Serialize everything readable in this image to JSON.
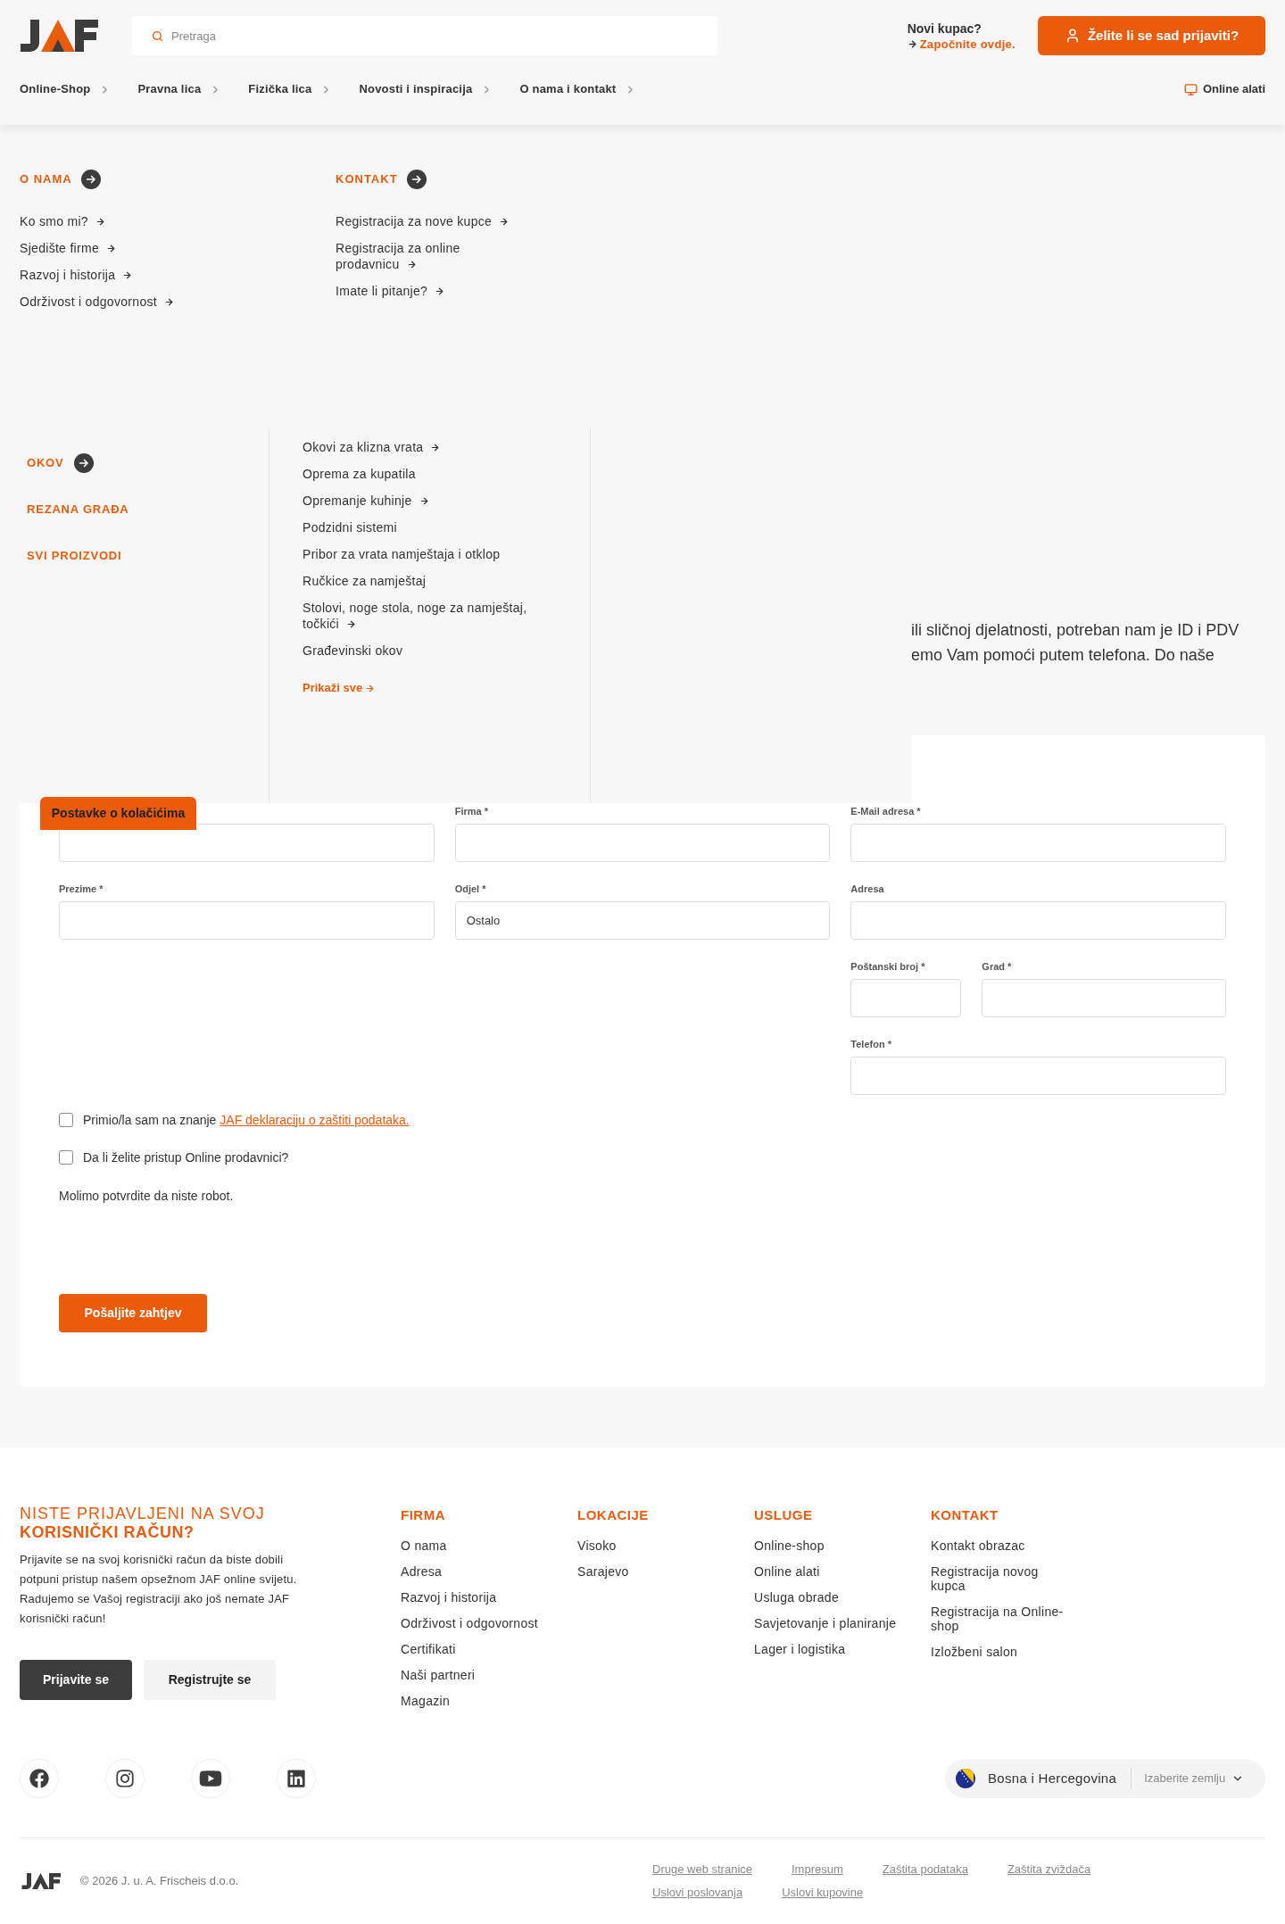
{
  "header": {
    "search": {
      "placeholder": "Pretraga"
    },
    "new_customer": {
      "question": "Novi kupac?",
      "link": "Započnite ovdje."
    },
    "login_button": "Želite li se sad prijaviti?",
    "nav": [
      "Online-Shop",
      "Pravna lica",
      "Fizička lica",
      "Novosti i inspiracija",
      "O nama i kontakt"
    ],
    "online_tools": "Online alati"
  },
  "about_menu": [
    {
      "heading": "O NAMA",
      "items": [
        "Ko smo mi?",
        "Sjedište firme",
        "Razvoj i historija",
        "Održivost i odgovornost"
      ]
    },
    {
      "heading": "KONTAKT",
      "items": [
        "Registracija za nove kupce",
        "Registracija za online prodavnicu",
        "Imate li pitanje?"
      ]
    }
  ],
  "shop_menu": {
    "categories": [
      {
        "label": "OKOV",
        "selected": true
      },
      {
        "label": "REZANA GRAĐA",
        "selected": false
      },
      {
        "label": "SVI PROIZVODI",
        "selected": false
      }
    ],
    "items": [
      {
        "label": "Okovi za klizna vrata",
        "expandable": true
      },
      {
        "label": "Oprema za kupatila",
        "expandable": false
      },
      {
        "label": "Opremanje kuhinje",
        "expandable": true
      },
      {
        "label": "Podzidni sistemi",
        "expandable": false
      },
      {
        "label": "Pribor za vrata namještaja i otklop",
        "expandable": false
      },
      {
        "label": "Ručkice za namještaj",
        "expandable": false
      },
      {
        "label": "Stolovi, noge stola, noge za namještaj, točkići",
        "expandable": true
      },
      {
        "label": "Građevinski okov",
        "expandable": false
      }
    ],
    "show_all": "Prikaži sve"
  },
  "intro_fragment": [
    "ili sličnoj djelatnosti, potreban nam je ID i PDV",
    "emo Vam pomoći putem telefona. Do naše"
  ],
  "cookie_tab": "Postavke o kolačićima",
  "form": {
    "columns": [
      [
        {
          "kind": "input"
        },
        {
          "kind": "input",
          "label": "Prezime *"
        }
      ],
      [
        {
          "kind": "input",
          "label": "Firma *"
        },
        {
          "kind": "input",
          "label": "Odjel *",
          "value": "Ostalo"
        }
      ],
      [
        {
          "kind": "input",
          "label": "E-Mail adresa *"
        },
        {
          "kind": "input",
          "label": "Adresa"
        },
        {
          "kind": "pair",
          "fields": [
            {
              "kind": "input",
              "label": "Poštanski broj *"
            },
            {
              "kind": "input",
              "label": "Grad *"
            }
          ]
        },
        {
          "kind": "input",
          "label": "Telefon *"
        }
      ]
    ],
    "checkboxes": [
      {
        "text": "Primio/la sam na znanje",
        "link": "JAF deklaraciju o zaštiti podataka.",
        "checked": false
      },
      {
        "text": "Da li želite pristup Online prodavnici?",
        "checked": false
      }
    ],
    "captcha_note": "Molimo potvrdite da niste robot.",
    "submit": "Pošaljite zahtjev"
  },
  "footer": {
    "login_prompt": {
      "title": "NISTE PRIJAVLJENI NA SVOJ **KORISNIČKI RAČUN?**",
      "text": "Prijavite se na svoj korisnički račun da biste dobili potpuni pristup našem opsežnom JAF online svijetu. Radujemo se Vašoj registraciji ako još nemate JAF korisnički račun!",
      "buttons": [
        {
          "label": "Prijavite se",
          "kind": "primary"
        },
        {
          "label": "Registrujte se",
          "kind": "secondary"
        }
      ]
    },
    "columns": [
      {
        "heading": "FIRMA",
        "items": [
          "O nama",
          "Adresa",
          "Razvoj i historija",
          "Održivost i odgovornost",
          "Certifikati",
          "Naši partneri",
          "Magazin"
        ]
      },
      {
        "heading": "LOKACIJE",
        "items": [
          "Visoko",
          "Sarajevo"
        ]
      },
      {
        "heading": "USLUGE",
        "items": [
          "Online-shop",
          "Online alati",
          "Usluga obrade",
          "Savjetovanje i planiranje",
          "Lager i logistika"
        ]
      },
      {
        "heading": "KONTAKT",
        "items": [
          "Kontakt obrazac",
          "Registracija novog kupca",
          "Registracija na Online-shop",
          "Izložbeni salon"
        ]
      }
    ],
    "country": {
      "name": "Bosna i Hercegovina",
      "select_label": "Izaberite zemlju"
    },
    "copyright": "© 2026 J. u. A. Frischeis d.o.o.",
    "legal_links": [
      "Druge web stranice",
      "Impresum",
      "Zaštita podataka",
      "Zaštita zviždača",
      "Uslovi poslovanja",
      "Uslovi kupovine"
    ]
  }
}
